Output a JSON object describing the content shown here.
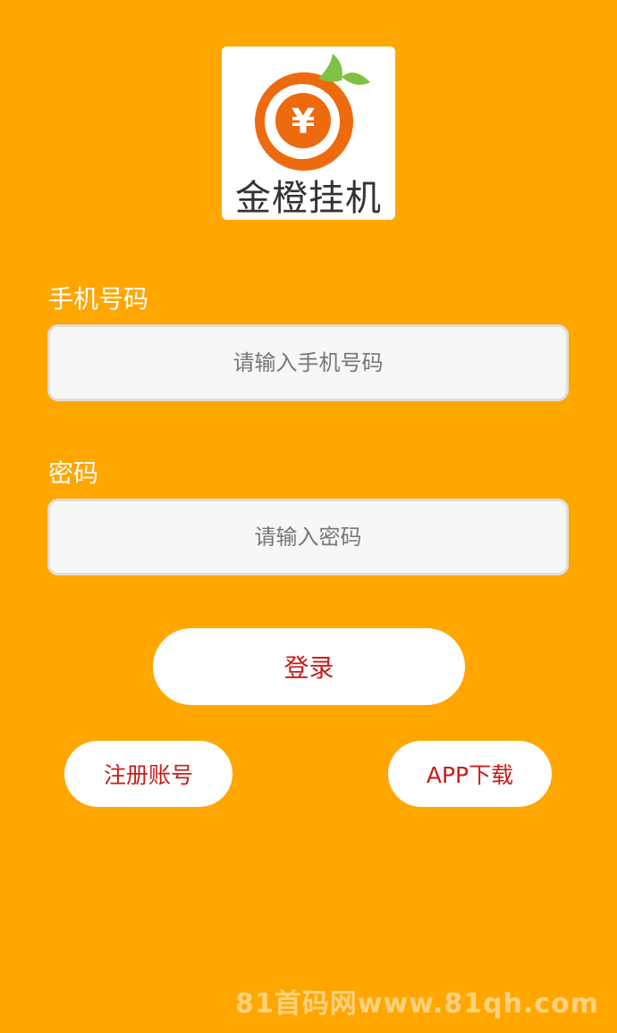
{
  "logo": {
    "icon": "orange-yuan-icon",
    "symbol": "¥",
    "name": "金橙挂机",
    "colors": {
      "orange": "#EE6A0F",
      "leaf": "#7DC242"
    }
  },
  "form": {
    "phone": {
      "label": "手机号码",
      "placeholder": "请输入手机号码",
      "value": ""
    },
    "password": {
      "label": "密码",
      "placeholder": "请输入密码",
      "value": ""
    }
  },
  "buttons": {
    "login": "登录",
    "register": "注册账号",
    "download": "APP下载"
  },
  "watermark": "81首码网www.81qh.com",
  "colors": {
    "background": "#FFA600",
    "button_text": "#C81B1B",
    "input_bg": "#F7F7F7"
  }
}
